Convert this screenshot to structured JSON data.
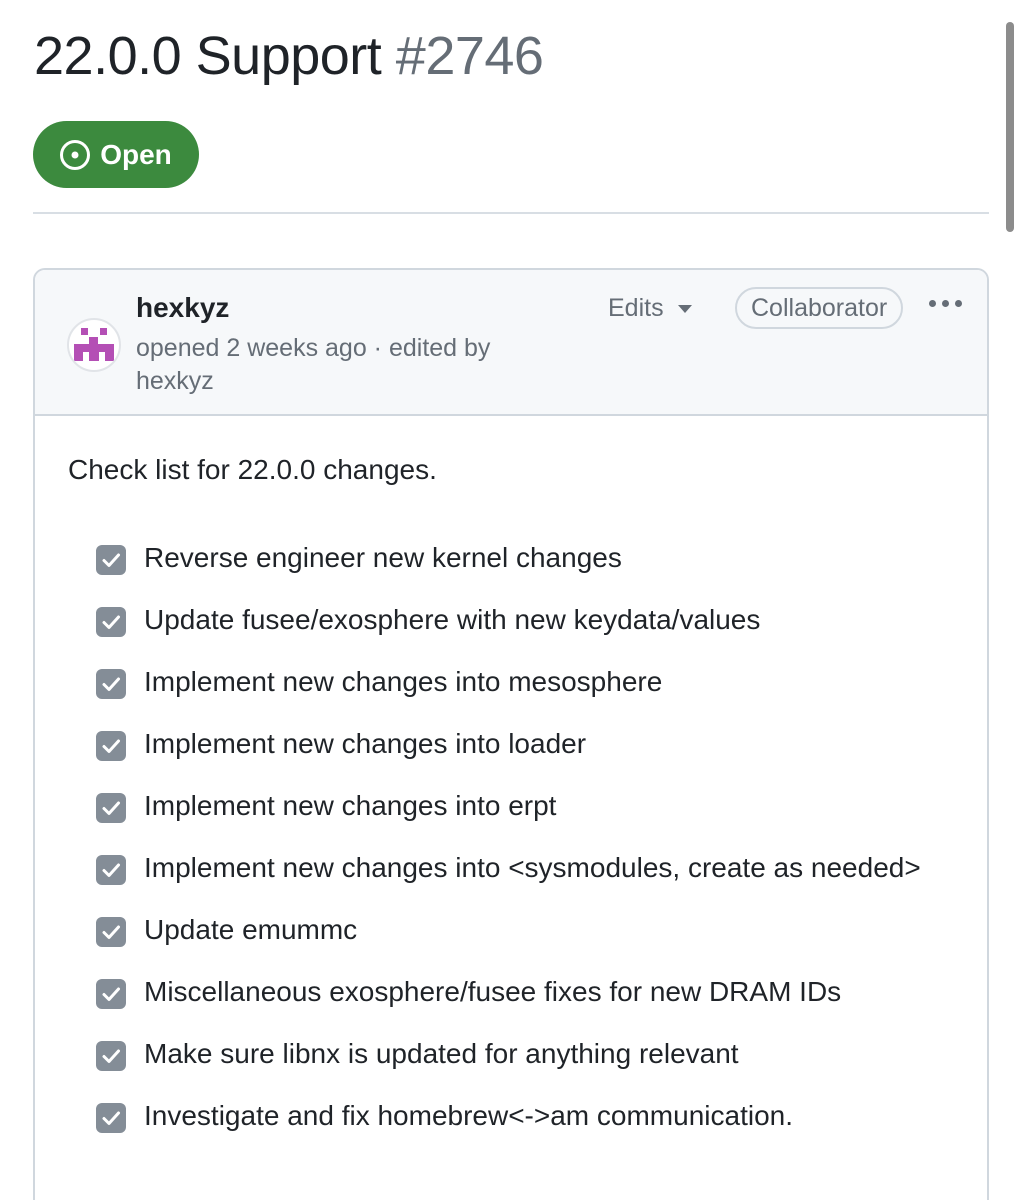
{
  "issue": {
    "title": "22.0.0 Support",
    "number": "#2746",
    "state": "Open"
  },
  "comment": {
    "author": "hexkyz",
    "meta": "opened 2 weeks ago · edited by hexkyz",
    "edits_label": "Edits",
    "role": "Collaborator",
    "intro": "Check list for 22.0.0 changes.",
    "tasks": [
      {
        "text": "Reverse engineer new kernel changes",
        "checked": true
      },
      {
        "text": "Update fusee/exosphere with new keydata/values",
        "checked": true
      },
      {
        "text": "Implement new changes into mesosphere",
        "checked": true
      },
      {
        "text": "Implement new changes into loader",
        "checked": true
      },
      {
        "text": "Implement new changes into erpt",
        "checked": true
      },
      {
        "text": "Implement new changes into <sysmodules, create as needed>",
        "checked": true
      },
      {
        "text": "Update emummc",
        "checked": true
      },
      {
        "text": "Miscellaneous exosphere/fusee fixes for new DRAM IDs",
        "checked": true
      },
      {
        "text": "Make sure libnx is updated for anything relevant",
        "checked": true
      },
      {
        "text": "Investigate and fix homebrew<->am communication.",
        "checked": true
      }
    ]
  },
  "colors": {
    "open_badge": "#3c8a3e",
    "checkbox": "#848d97",
    "avatar": "#b44fb5"
  },
  "icons": {
    "state": "issue-opened-icon",
    "edits": "caret-down-icon",
    "menu": "kebab-horizontal-icon",
    "task": "checkbox-checked-icon"
  }
}
